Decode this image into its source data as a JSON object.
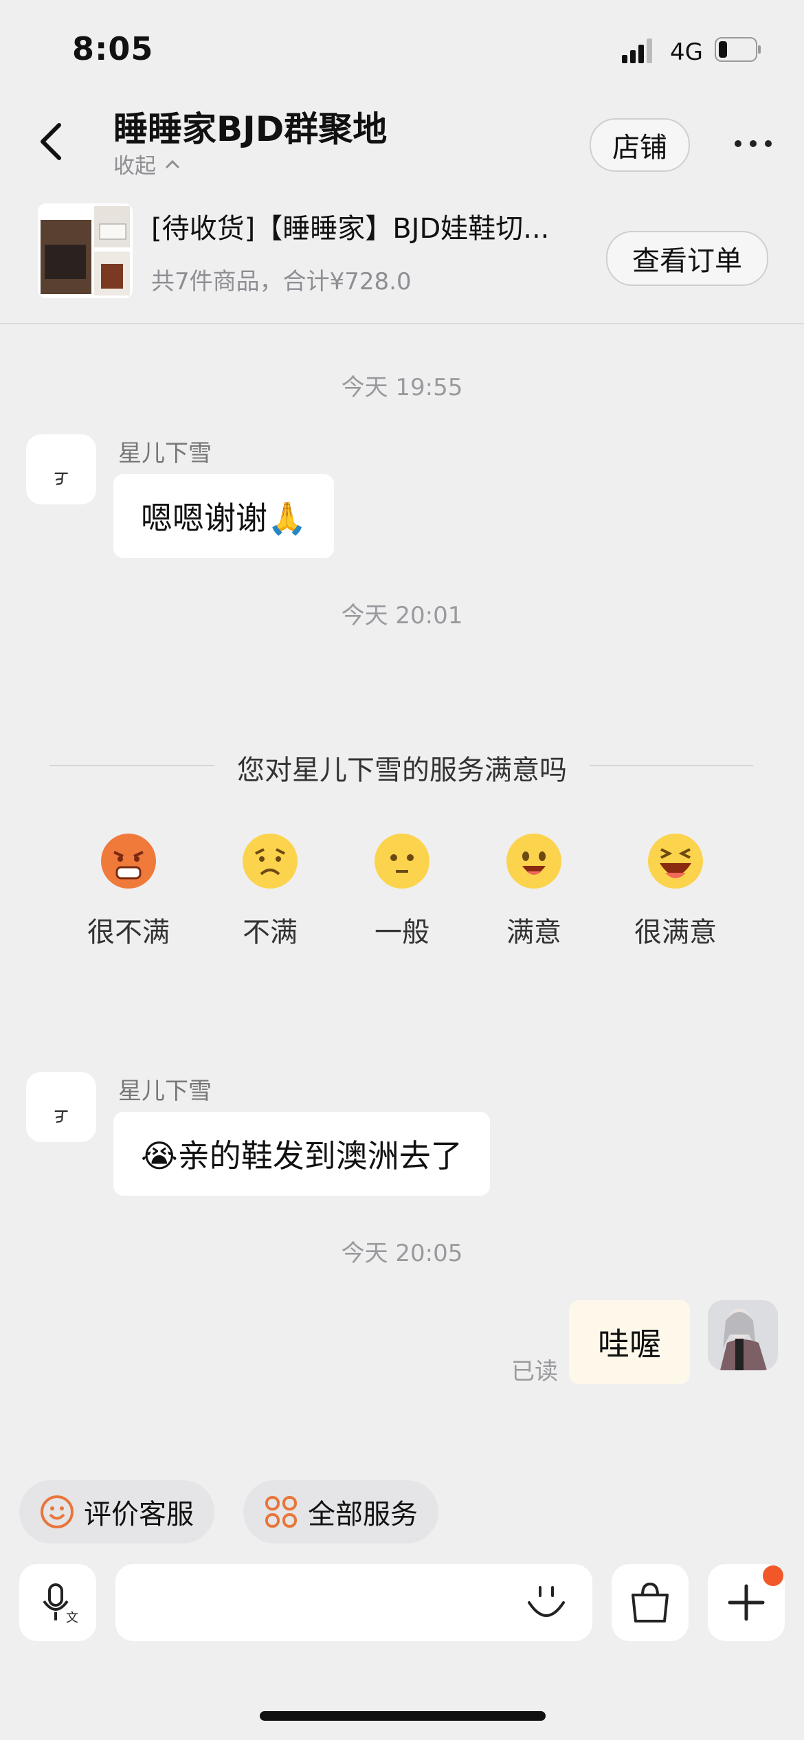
{
  "status_bar": {
    "time": "8:05",
    "network": "4G"
  },
  "header": {
    "title": "睡睡家BJD群聚地",
    "collapse_label": "收起",
    "shop_button": "店铺"
  },
  "order": {
    "title": "[待收货]【睡睡家】BJD娃鞋切...",
    "summary": "共7件商品，合计¥728.0",
    "view_button": "查看订单"
  },
  "messages": [
    {
      "timestamp": "今天 19:55",
      "sender": "星儿下雪",
      "avatar_text": "ᢖ",
      "text": "嗯嗯谢谢🙏"
    },
    {
      "timestamp": "今天 20:01"
    }
  ],
  "survey": {
    "question": "您对星儿下雪的服务满意吗",
    "options": [
      "很不满",
      "不满",
      "一般",
      "满意",
      "很满意"
    ]
  },
  "message2": {
    "sender": "星儿下雪",
    "avatar_text": "ᢖ",
    "text": "😭亲的鞋发到澳洲去了"
  },
  "message3": {
    "timestamp": "今天 20:05",
    "text": "哇喔",
    "read_status": "已读"
  },
  "services": {
    "rate_label": "评价客服",
    "all_label": "全部服务"
  },
  "colors": {
    "accent": "#f2572a",
    "emoji_yellow": "#fcd34d",
    "sent_bubble": "#fdf8ea"
  }
}
